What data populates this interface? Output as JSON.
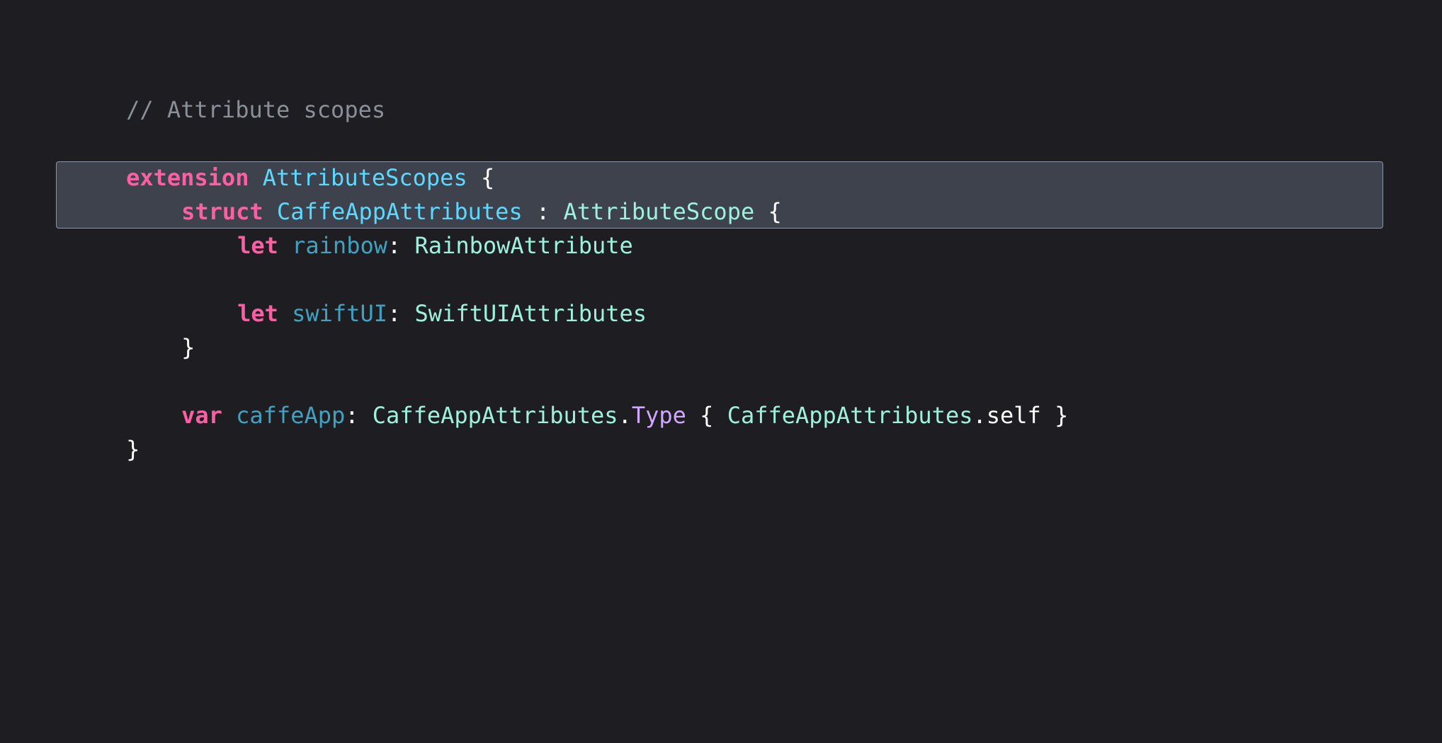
{
  "colors": {
    "background": "#1e1e22",
    "comment": "#8a8f98",
    "keyword": "#fc5fa3",
    "type_declaration": "#5dd8ff",
    "identifier": "#41a1c0",
    "type_name": "#9ef1dd",
    "member": "#d0a8ff",
    "plain": "#ffffff",
    "highlight_fill": "#505868",
    "highlight_border": "#aab2c0"
  },
  "code": {
    "comment": "// Attribute scopes",
    "line_extension": {
      "keyword": "extension",
      "type": "AttributeScopes",
      "brace": "{"
    },
    "line_struct": {
      "keyword": "struct",
      "type": "CaffeAppAttributes",
      "colon": ":",
      "conforms": "AttributeScope",
      "brace": "{"
    },
    "line_rainbow": {
      "keyword": "let",
      "name": "rainbow",
      "colon": ":",
      "type": "RainbowAttribute"
    },
    "line_swiftui": {
      "keyword": "let",
      "name": "swiftUI",
      "colon": ":",
      "type": "SwiftUIAttributes"
    },
    "line_struct_close": "}",
    "line_var": {
      "keyword": "var",
      "name": "caffeApp",
      "colon": ":",
      "type": "CaffeAppAttributes",
      "dot": ".",
      "member": "Type",
      "open_brace": "{",
      "body_type": "CaffeAppAttributes",
      "body_member": ".self",
      "close_brace": "}"
    },
    "line_extension_close": "}"
  }
}
